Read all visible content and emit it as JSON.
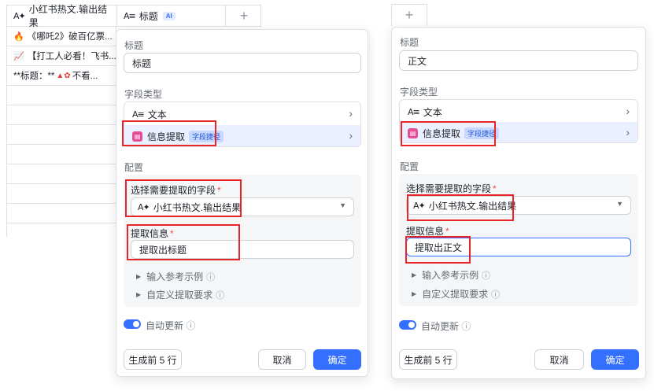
{
  "table": {
    "columns": [
      {
        "icon": "ai-text-icon",
        "label": "小红书热文.输出结果"
      },
      {
        "icon": "text-icon",
        "label": "标题",
        "badge": "AI"
      },
      {
        "label": "+"
      }
    ],
    "rows": [
      "《哪吒2》破百亿票...",
      "【打工人必看！飞书...",
      "**标题：**",
      "不看..."
    ]
  },
  "left_panel": {
    "title_label": "标题",
    "title_value": "标题",
    "field_type_label": "字段类型",
    "type_text": "文本",
    "type_extract": "信息提取",
    "type_extract_tag": "字段捷径",
    "config_label": "配置",
    "select_field_label": "选择需要提取的字段",
    "select_field_value": "小红书热文.输出结果",
    "extract_info_label": "提取信息",
    "extract_info_value": "提取出标题",
    "example_label": "输入参考示例",
    "custom_label": "自定义提取要求",
    "auto_update_label": "自动更新",
    "generate_label": "生成前 5 行",
    "cancel_label": "取消",
    "confirm_label": "确定"
  },
  "right_panel": {
    "plus_label": "+",
    "title_label": "标题",
    "title_value": "正文",
    "field_type_label": "字段类型",
    "type_text": "文本",
    "type_extract": "信息提取",
    "type_extract_tag": "字段捷径",
    "config_label": "配置",
    "select_field_label": "选择需要提取的字段",
    "select_field_value": "小红书热文.输出结果",
    "extract_info_label": "提取信息",
    "extract_info_value": "提取出正文",
    "example_label": "输入参考示例",
    "custom_label": "自定义提取要求",
    "auto_update_label": "自动更新",
    "generate_label": "生成前 5 行",
    "cancel_label": "取消",
    "confirm_label": "确定"
  },
  "colors": {
    "accent": "#3370ff",
    "highlight_box": "#e8262a"
  }
}
